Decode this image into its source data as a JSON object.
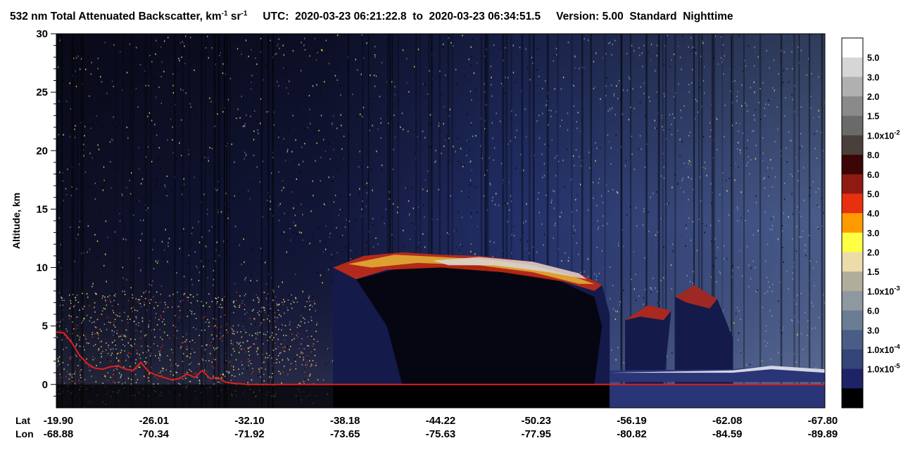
{
  "title": {
    "main": "532 nm Total Attenuated Backscatter, km",
    "unit_sup1": "-1",
    "unit_mid": " sr",
    "unit_sup2": "-1",
    "utc_label": "UTC:",
    "utc_start": "2020-03-23 06:21:22.8",
    "utc_to": "to",
    "utc_end": "2020-03-23 06:34:51.5",
    "version": "Version: 5.00",
    "mode": "Standard",
    "time_of_day": "Nighttime"
  },
  "chart_data": {
    "type": "heatmap",
    "ylabel": "Altitude, km",
    "ylim": [
      -2,
      30
    ],
    "yticks": [
      0,
      5,
      10,
      15,
      20,
      25,
      30
    ],
    "x_rows": [
      {
        "name": "Lat",
        "values": [
          "-19.90",
          "-26.01",
          "-32.10",
          "-38.18",
          "-44.22",
          "-50.23",
          "-56.19",
          "-62.08",
          "-67.80"
        ]
      },
      {
        "name": "Lon",
        "values": [
          "-68.88",
          "-70.34",
          "-71.92",
          "-73.65",
          "-75.63",
          "-77.95",
          "-80.82",
          "-84.59",
          "-89.89"
        ]
      }
    ],
    "colorbar": {
      "colors": [
        "#ffffff",
        "#d6d6d6",
        "#b0b0b0",
        "#8a8a8a",
        "#6a6a6a",
        "#4a3f3b",
        "#3a0606",
        "#8e1a12",
        "#e8300e",
        "#ff9a00",
        "#ffff44",
        "#ecdcaa",
        "#b0ae9a",
        "#8e98a0",
        "#6a7d94",
        "#4a5d86",
        "#354478",
        "#1e2266",
        "#000000"
      ],
      "labels": [
        {
          "base": "5.0"
        },
        {
          "base": "3.0"
        },
        {
          "base": "2.0"
        },
        {
          "base": "1.5"
        },
        {
          "base": "1.0x10",
          "exp": "-2"
        },
        {
          "base": "8.0"
        },
        {
          "base": "6.0"
        },
        {
          "base": "5.0"
        },
        {
          "base": "4.0"
        },
        {
          "base": "3.0"
        },
        {
          "base": "2.0"
        },
        {
          "base": "1.5"
        },
        {
          "base": "1.0x10",
          "exp": "-3"
        },
        {
          "base": "6.0"
        },
        {
          "base": "3.0"
        },
        {
          "base": "1.0x10",
          "exp": "-4"
        },
        {
          "base": "1.0x10",
          "exp": "-5"
        }
      ]
    },
    "surface_elevation_km": [
      [
        0.0,
        4.5
      ],
      [
        0.01,
        4.4
      ],
      [
        0.02,
        3.6
      ],
      [
        0.03,
        2.5
      ],
      [
        0.04,
        1.8
      ],
      [
        0.05,
        1.4
      ],
      [
        0.06,
        1.3
      ],
      [
        0.07,
        1.5
      ],
      [
        0.08,
        1.6
      ],
      [
        0.09,
        1.3
      ],
      [
        0.1,
        1.2
      ],
      [
        0.11,
        1.9
      ],
      [
        0.12,
        1.1
      ],
      [
        0.13,
        0.8
      ],
      [
        0.14,
        0.6
      ],
      [
        0.15,
        0.4
      ],
      [
        0.16,
        0.5
      ],
      [
        0.17,
        0.9
      ],
      [
        0.18,
        0.6
      ],
      [
        0.19,
        1.2
      ],
      [
        0.2,
        0.5
      ],
      [
        0.21,
        0.6
      ],
      [
        0.22,
        0.2
      ],
      [
        0.23,
        0.1
      ],
      [
        0.24,
        0.05
      ],
      [
        0.25,
        0.0
      ],
      [
        1.0,
        0.0
      ]
    ]
  }
}
